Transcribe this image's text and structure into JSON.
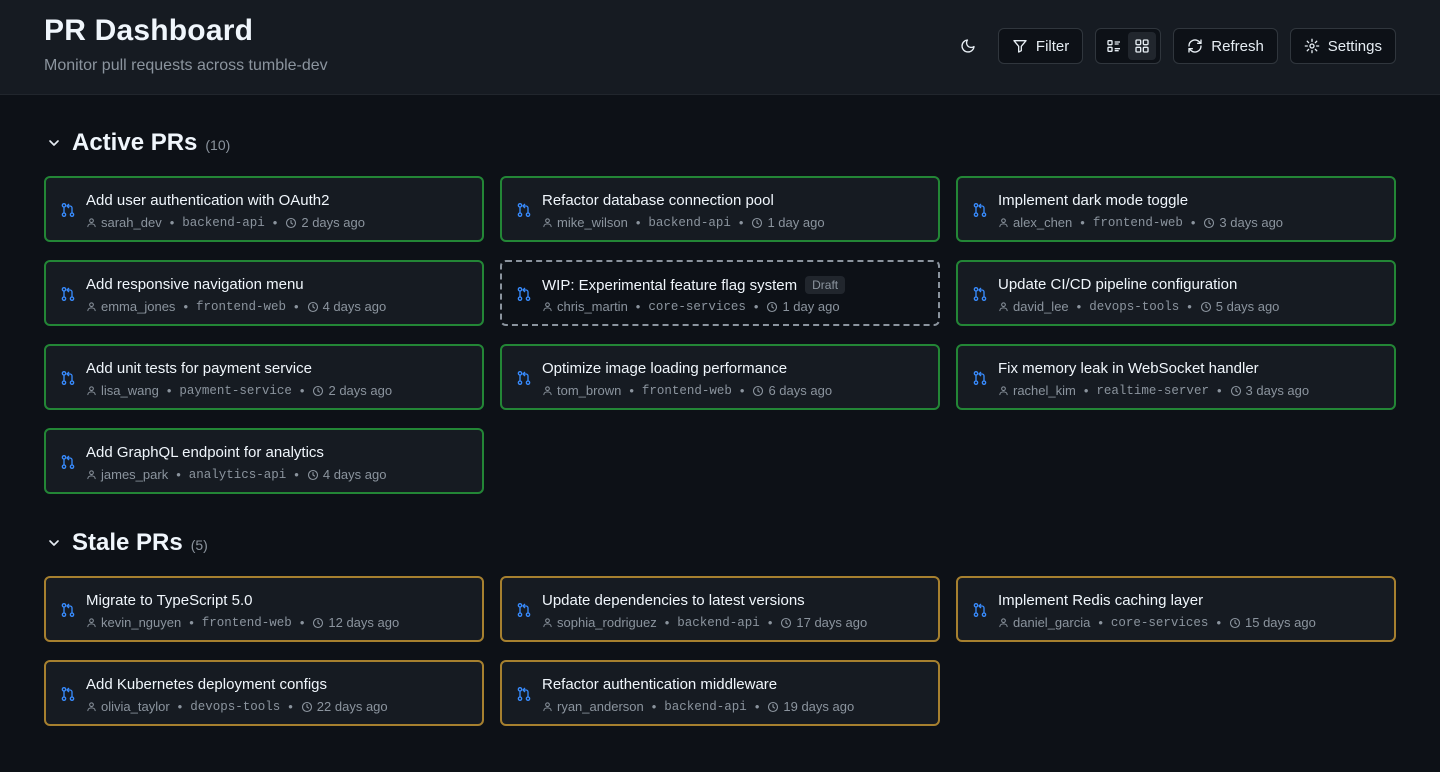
{
  "header": {
    "title": "PR Dashboard",
    "subtitle": "Monitor pull requests across tumble-dev",
    "filter_label": "Filter",
    "refresh_label": "Refresh",
    "settings_label": "Settings"
  },
  "colors": {
    "active_border": "#238636",
    "stale_border": "#a6802f",
    "draft_border": "#8b949e",
    "pr_icon": "#388bfd"
  },
  "active": {
    "title": "Active PRs",
    "count": "(10)",
    "prs": [
      {
        "title": "Add user authentication with OAuth2",
        "author": "sarah_dev",
        "repo": "backend-api",
        "age": "2 days ago"
      },
      {
        "title": "Refactor database connection pool",
        "author": "mike_wilson",
        "repo": "backend-api",
        "age": "1 day ago"
      },
      {
        "title": "Implement dark mode toggle",
        "author": "alex_chen",
        "repo": "frontend-web",
        "age": "3 days ago"
      },
      {
        "title": "Add responsive navigation menu",
        "author": "emma_jones",
        "repo": "frontend-web",
        "age": "4 days ago"
      },
      {
        "title": "WIP: Experimental feature flag system",
        "badge": "Draft",
        "author": "chris_martin",
        "repo": "core-services",
        "age": "1 day ago"
      },
      {
        "title": "Update CI/CD pipeline configuration",
        "author": "david_lee",
        "repo": "devops-tools",
        "age": "5 days ago"
      },
      {
        "title": "Add unit tests for payment service",
        "author": "lisa_wang",
        "repo": "payment-service",
        "age": "2 days ago"
      },
      {
        "title": "Optimize image loading performance",
        "author": "tom_brown",
        "repo": "frontend-web",
        "age": "6 days ago"
      },
      {
        "title": "Fix memory leak in WebSocket handler",
        "author": "rachel_kim",
        "repo": "realtime-server",
        "age": "3 days ago"
      },
      {
        "title": "Add GraphQL endpoint for analytics",
        "author": "james_park",
        "repo": "analytics-api",
        "age": "4 days ago"
      }
    ]
  },
  "stale": {
    "title": "Stale PRs",
    "count": "(5)",
    "prs": [
      {
        "title": "Migrate to TypeScript 5.0",
        "author": "kevin_nguyen",
        "repo": "frontend-web",
        "age": "12 days ago"
      },
      {
        "title": "Update dependencies to latest versions",
        "author": "sophia_rodriguez",
        "repo": "backend-api",
        "age": "17 days ago"
      },
      {
        "title": "Implement Redis caching layer",
        "author": "daniel_garcia",
        "repo": "core-services",
        "age": "15 days ago"
      },
      {
        "title": "Add Kubernetes deployment configs",
        "author": "olivia_taylor",
        "repo": "devops-tools",
        "age": "22 days ago"
      },
      {
        "title": "Refactor authentication middleware",
        "author": "ryan_anderson",
        "repo": "backend-api",
        "age": "19 days ago"
      }
    ]
  }
}
